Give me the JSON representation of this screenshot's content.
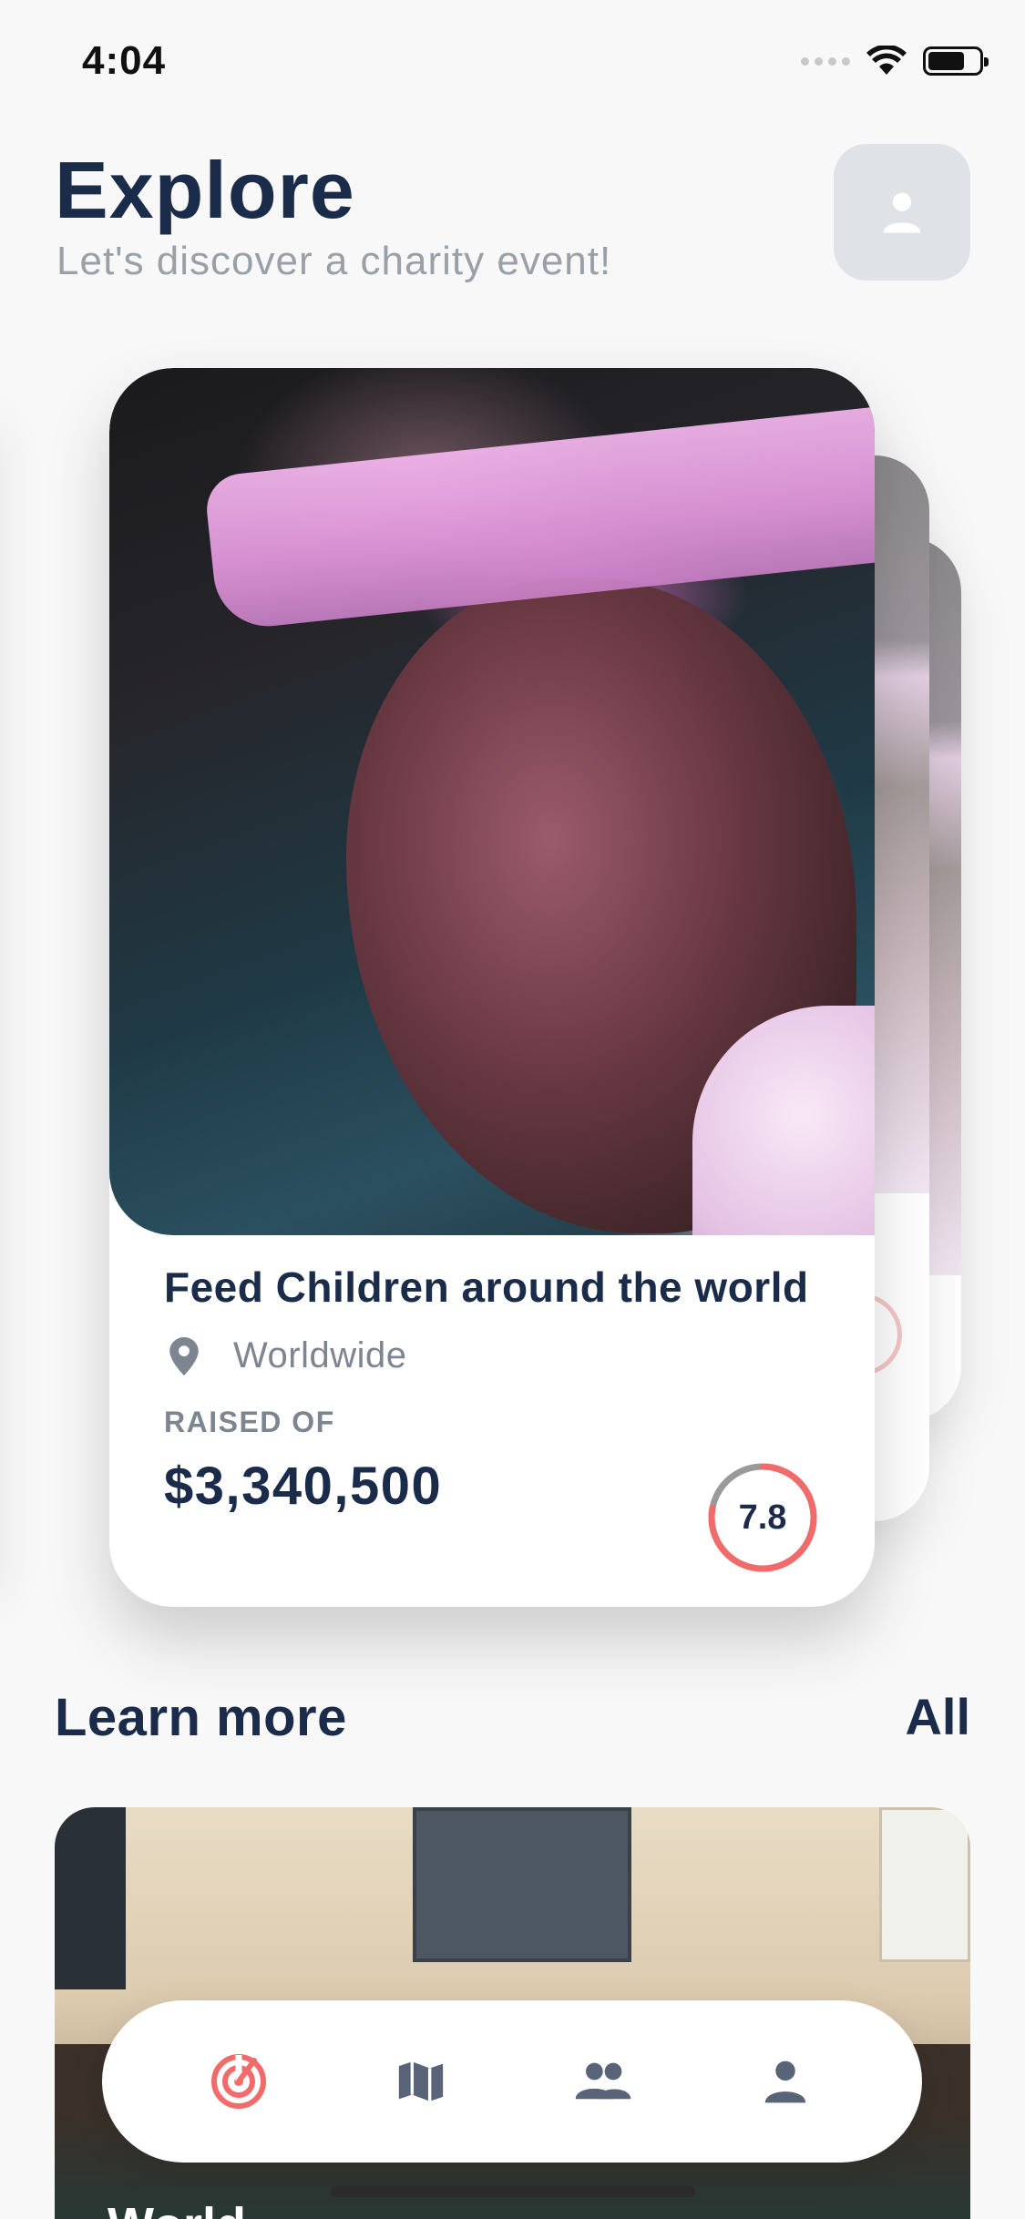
{
  "status_bar": {
    "time": "4:04"
  },
  "header": {
    "title": "Explore",
    "subtitle": "Let's discover a charity event!",
    "profile_icon": "person-icon"
  },
  "featured_event": {
    "title": "Feed Children around the world",
    "location": "Worldwide",
    "raised_label": "RAISED OF",
    "raised_amount": "$3,340,500",
    "score": "7.8",
    "score_ring_color": "#f26b6b"
  },
  "learn_more": {
    "title": "Learn more",
    "link_label": "All",
    "article_title": "World"
  },
  "bottom_nav": {
    "items": [
      {
        "icon": "radar-icon",
        "active": true
      },
      {
        "icon": "map-icon",
        "active": false
      },
      {
        "icon": "people-icon",
        "active": false
      },
      {
        "icon": "person-icon",
        "active": false
      }
    ],
    "active_color": "#f26b6b",
    "inactive_color": "#5a6478"
  }
}
